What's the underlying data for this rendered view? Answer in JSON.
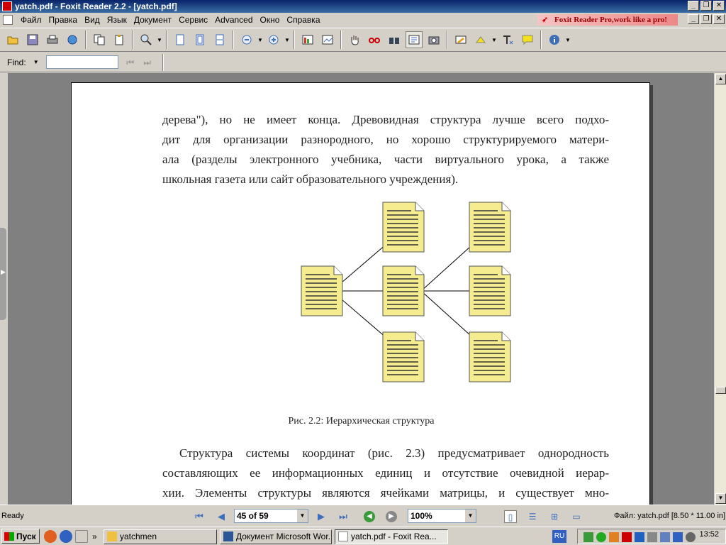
{
  "window": {
    "title": "yatch.pdf - Foxit Reader 2.2 - [yatch.pdf]",
    "minimize": "_",
    "restore": "❐",
    "close": "✕"
  },
  "menu": {
    "items": [
      "Файл",
      "Правка",
      "Вид",
      "Язык",
      "Документ",
      "Сервис",
      "Advanced",
      "Окно",
      "Справка"
    ],
    "promo": "Foxit Reader Pro,work like a pro!"
  },
  "findbar": {
    "label": "Find:",
    "value": ""
  },
  "page": {
    "paragraph1": [
      "дерева\"), но не имеет конца. Древовидная структура лучше всего подхо-",
      "дит для организации разнородного, но хорошо структурируемого матери-",
      "ала (разделы электронного учебника, части виртуального урока, а также",
      "школьная газета или сайт образовательного учреждения)."
    ],
    "caption": "Рис. 2.2: Иерархическая структура",
    "paragraph2": [
      "Структура системы координат (рис. 2.3) предусматривает однородность",
      "составляющих ее информационных единиц и отсутствие очевидной иерар-",
      "хии. Элементы структуры являются ячейками матрицы, и существует мно-"
    ]
  },
  "statusbar": {
    "status": "Ready",
    "page_indicator": "45 of 59",
    "zoom": "100%",
    "file_info": "Файл: yatch.pdf [8.50 * 11.00 in]"
  },
  "taskbar": {
    "start": "Пуск",
    "more": "»",
    "tasks": [
      "yatchmen",
      "Документ Microsoft Wor...",
      "yatch.pdf - Foxit Rea..."
    ],
    "lang": "RU",
    "clock": "13:52"
  },
  "colors": {
    "title_bar": "#0a246a",
    "doc_background": "#808080",
    "page": "#ffffff",
    "doc_icon_fill": "#f5ec8f"
  }
}
